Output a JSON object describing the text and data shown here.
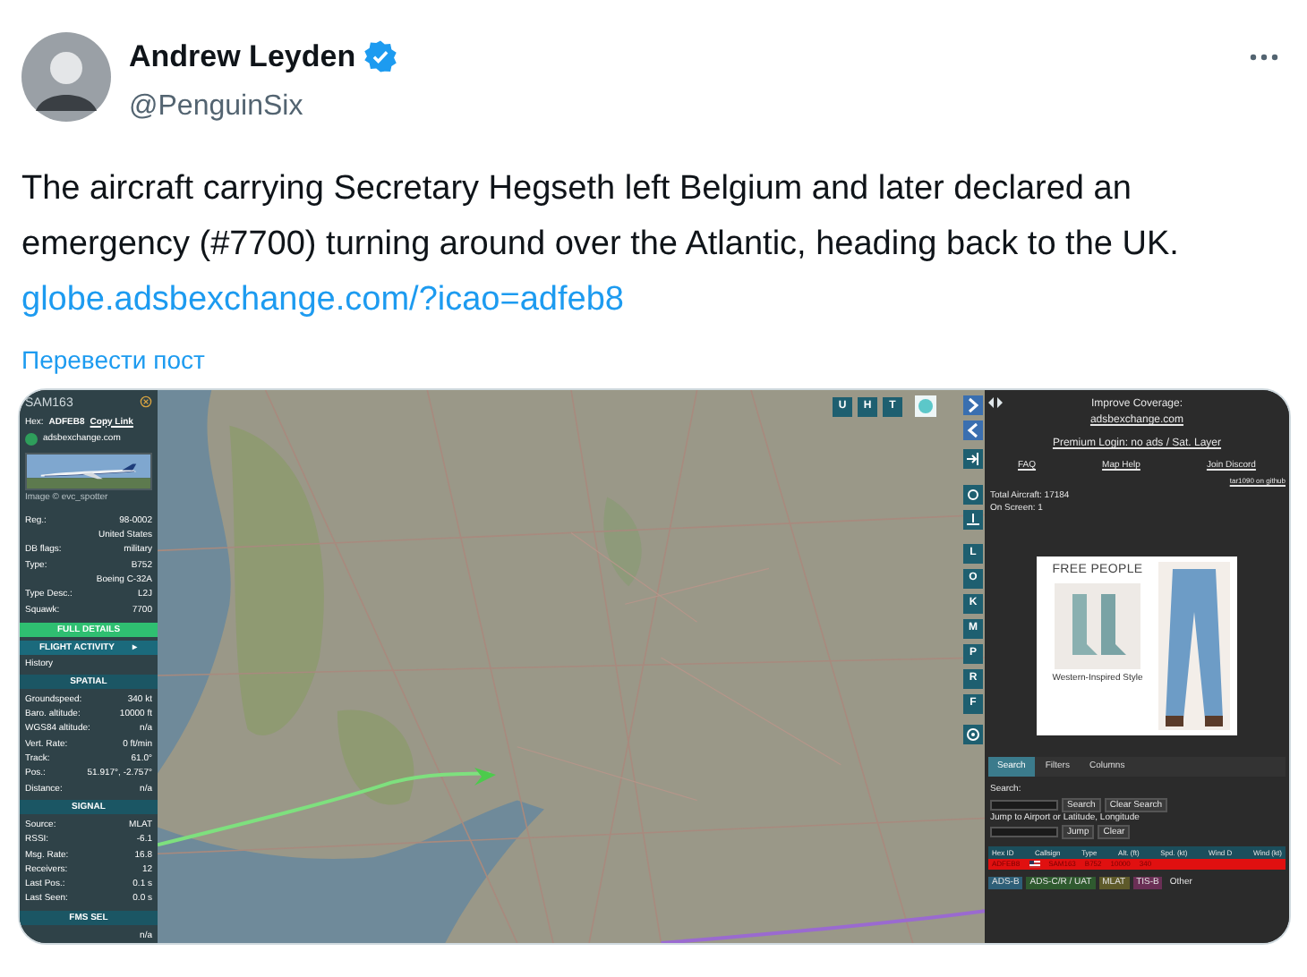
{
  "tweet": {
    "author": "Andrew Leyden",
    "verified": true,
    "handle": "@PenguinSix",
    "text": "The aircraft carrying Secretary Hegseth left Belgium and later declared an emergency (#7700) turning around over the Atlantic, heading back to the UK.",
    "link": "globe.adsbexchange.com/?icao=adfeb8",
    "translate": "Перевести пост"
  },
  "tracker": {
    "sidebar": {
      "callsign": "SAM163",
      "hex_label": "Hex:",
      "hex": "ADFEB8",
      "copy_link": "Copy Link",
      "site": "adsbexchange.com",
      "image_credit": "Image © evc_spotter",
      "details": [
        {
          "label": "Reg.:",
          "value": "98-0002"
        },
        {
          "value": "United States"
        },
        {
          "label": "DB flags:",
          "value": "military"
        },
        {
          "label": "Type:",
          "value": "B752"
        },
        {
          "value": "Boeing C-32A"
        },
        {
          "label": "Type Desc.:",
          "value": "L2J"
        },
        {
          "label": "Squawk:",
          "value": "7700"
        }
      ],
      "full_details": "FULL DETAILS",
      "flight_activity": "FLIGHT ACTIVITY",
      "flight_activity_arrow": "▸",
      "history": "History",
      "sections": [
        {
          "title": "SPATIAL",
          "rows": [
            {
              "label": "Groundspeed:",
              "value": "340 kt"
            },
            {
              "label": "Baro. altitude:",
              "value": "10000 ft"
            },
            {
              "label": "WGS84 altitude:",
              "value": "n/a"
            },
            {
              "label": "Vert. Rate:",
              "value": "0 ft/min"
            },
            {
              "label": "Track:",
              "value": "61.0°"
            },
            {
              "label": "Pos.:",
              "value": "51.917°, -2.757°"
            },
            {
              "label": "Distance:",
              "value": "n/a"
            }
          ]
        },
        {
          "title": "SIGNAL",
          "rows": [
            {
              "label": "Source:",
              "value": "MLAT"
            },
            {
              "label": "RSSI:",
              "value": "-6.1"
            },
            {
              "label": "Msg. Rate:",
              "value": "16.8"
            },
            {
              "label": "Receivers:",
              "value": "12"
            },
            {
              "label": "Last Pos.:",
              "value": "0.1 s"
            },
            {
              "label": "Last Seen:",
              "value": "0.0 s"
            }
          ]
        },
        {
          "title": "FMS SEL",
          "rows": [
            {
              "value": "n/a"
            }
          ]
        }
      ]
    },
    "map_buttons": {
      "top": [
        "U",
        "H",
        "T"
      ],
      "side": [
        "L",
        "O",
        "K",
        "M",
        "P",
        "R",
        "F"
      ]
    },
    "info": {
      "improve": "Improve Coverage:",
      "improve_link": "adsbexchange.com",
      "premium": "Premium Login: no ads / Sat. Layer",
      "links": [
        "FAQ",
        "Map Help",
        "Join Discord"
      ],
      "github": "tar1090 on github",
      "total": "Total Aircraft: 17184",
      "on_screen": "On Screen: 1"
    },
    "ad": {
      "brand": "FREE PEOPLE",
      "caption": "Western-Inspired Style"
    },
    "tabs": [
      {
        "label": "Search",
        "selected": true
      },
      {
        "label": "Filters",
        "selected": false
      },
      {
        "label": "Columns",
        "selected": false
      }
    ],
    "search": {
      "label": "Search:",
      "buttons": [
        "Search",
        "Clear Search"
      ],
      "jump_label": "Jump to Airport or Latitude, Longitude",
      "jump_buttons": [
        "Jump",
        "Clear"
      ]
    },
    "table": {
      "columns": [
        "Hex ID",
        "Callsign",
        "Type",
        "Alt. (ft)",
        "Spd. (kt)",
        "Wind D",
        "Wind (kt)"
      ],
      "rows": [
        {
          "emergency": true,
          "cells": [
            "ADFEB8",
            "SAM163",
            "B752",
            "10000",
            "340"
          ]
        }
      ]
    },
    "legend": [
      {
        "label": "ADS-B",
        "color": "#2e5f78"
      },
      {
        "label": "ADS-C/R / UAT",
        "color": "#2f5a2f"
      },
      {
        "label": "MLAT",
        "color": "#5e5a2a"
      },
      {
        "label": "TIS-B",
        "color": "#6a2f55"
      },
      {
        "label": "Other",
        "color": "#2b2b2b"
      }
    ]
  }
}
